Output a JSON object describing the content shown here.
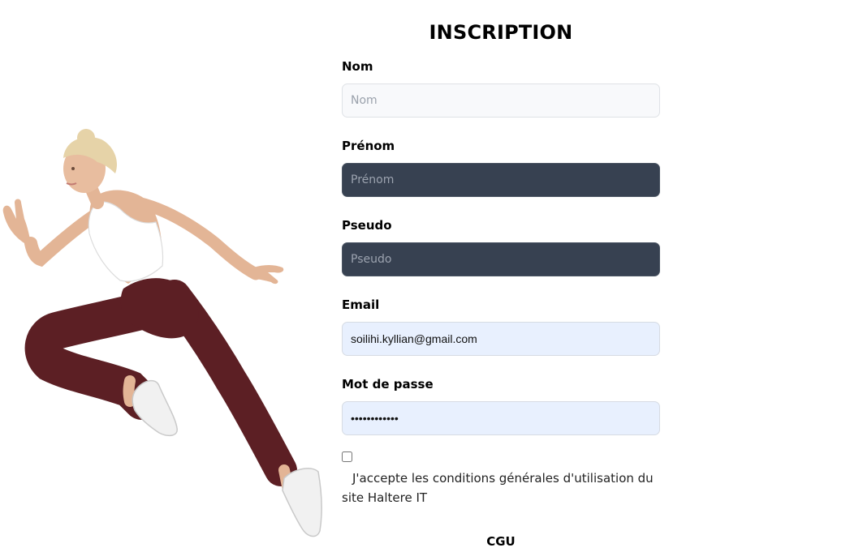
{
  "form": {
    "title": "INSCRIPTION",
    "fields": [
      {
        "label": "Nom",
        "placeholder": "Nom",
        "value": ""
      },
      {
        "label": "Prénom",
        "placeholder": "Prénom",
        "value": ""
      },
      {
        "label": "Pseudo",
        "placeholder": "Pseudo",
        "value": ""
      },
      {
        "label": "Email",
        "placeholder": "",
        "value": "soilihi.kyllian@gmail.com"
      },
      {
        "label": "Mot de passe",
        "placeholder": "",
        "value": "••••••••••••"
      }
    ],
    "terms_text": "J'accepte les conditions générales d'utilisation du site Haltere IT",
    "terms_checked": false,
    "cgu_link": "CGU"
  },
  "colors": {
    "dark_input": "#374151",
    "autofill_input": "#e8f0fe",
    "light_input": "#f8f9fb",
    "leggings": "#5c1f24",
    "top": "#ffffff"
  },
  "hero_image": {
    "icon": "running-woman-illustration"
  }
}
